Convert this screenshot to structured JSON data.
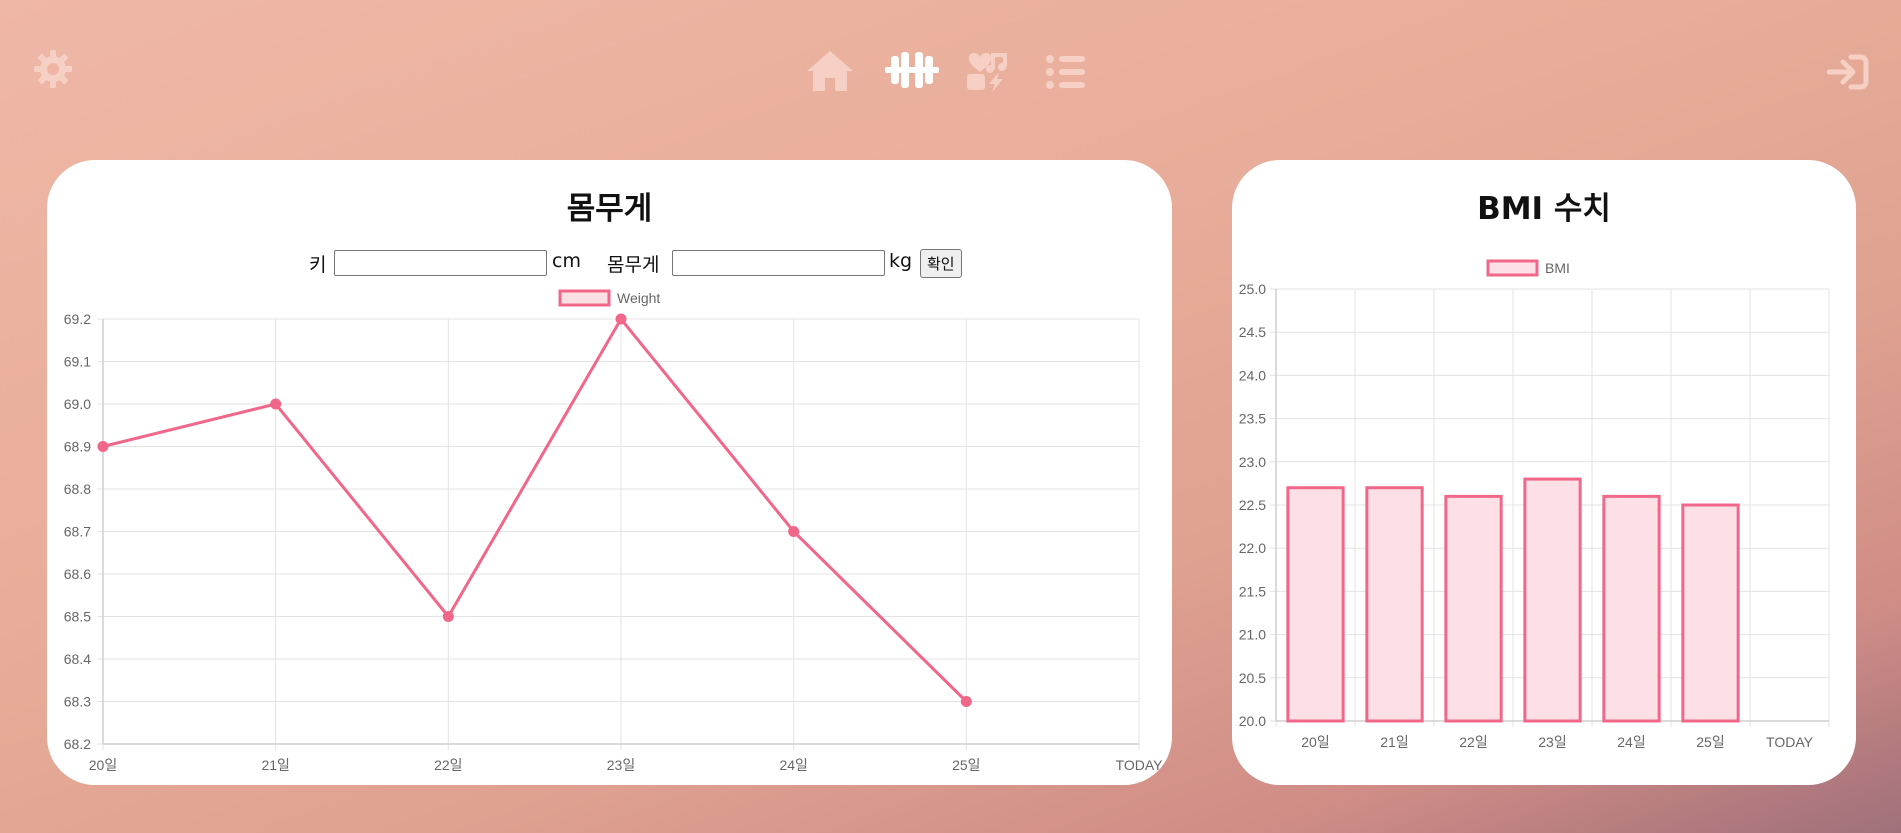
{
  "nav": {
    "settings_icon": "gear-icon",
    "items": [
      {
        "icon": "home-icon",
        "active": false
      },
      {
        "icon": "dumbbell-icon",
        "active": true
      },
      {
        "icon": "heart-music-icon",
        "active": false
      },
      {
        "icon": "list-icon",
        "active": false
      }
    ],
    "logout_icon": "sign-in-icon"
  },
  "colors": {
    "accent": "#f0678a",
    "accent_fill": "#fde0e6",
    "nav_icon": "#f6cfc5",
    "nav_icon_active": "#ffffff"
  },
  "weight_card": {
    "title": "몸무게",
    "height_label": "키",
    "height_unit": "cm",
    "height_value": "",
    "weight_label": "몸무게",
    "weight_unit": "kg",
    "weight_value": "",
    "confirm_label": "확인"
  },
  "bmi_card": {
    "title": "BMI 수치"
  },
  "chart_data": [
    {
      "type": "line",
      "legend": "Weight",
      "legend_position": "top",
      "grid": true,
      "categories": [
        "20일",
        "21일",
        "22일",
        "23일",
        "24일",
        "25일",
        "TODAY"
      ],
      "series": [
        {
          "name": "Weight",
          "values": [
            68.9,
            69.0,
            68.5,
            69.2,
            68.7,
            68.3,
            null
          ]
        }
      ],
      "ylim": [
        68.2,
        69.2
      ],
      "yticks": [
        "69.2",
        "69.1",
        "69.0",
        "68.9",
        "68.8",
        "68.7",
        "68.6",
        "68.5",
        "68.4",
        "68.3",
        "68.2"
      ]
    },
    {
      "type": "bar",
      "legend": "BMI",
      "legend_position": "top",
      "grid": true,
      "categories": [
        "20일",
        "21일",
        "22일",
        "23일",
        "24일",
        "25일",
        "TODAY"
      ],
      "series": [
        {
          "name": "BMI",
          "values": [
            22.7,
            22.7,
            22.6,
            22.8,
            22.6,
            22.5,
            null
          ]
        }
      ],
      "ylim": [
        20.0,
        25.0
      ],
      "yticks": [
        "25.0",
        "24.5",
        "24.0",
        "23.5",
        "23.0",
        "22.5",
        "22.0",
        "21.5",
        "21.0",
        "20.5",
        "20.0"
      ]
    }
  ]
}
